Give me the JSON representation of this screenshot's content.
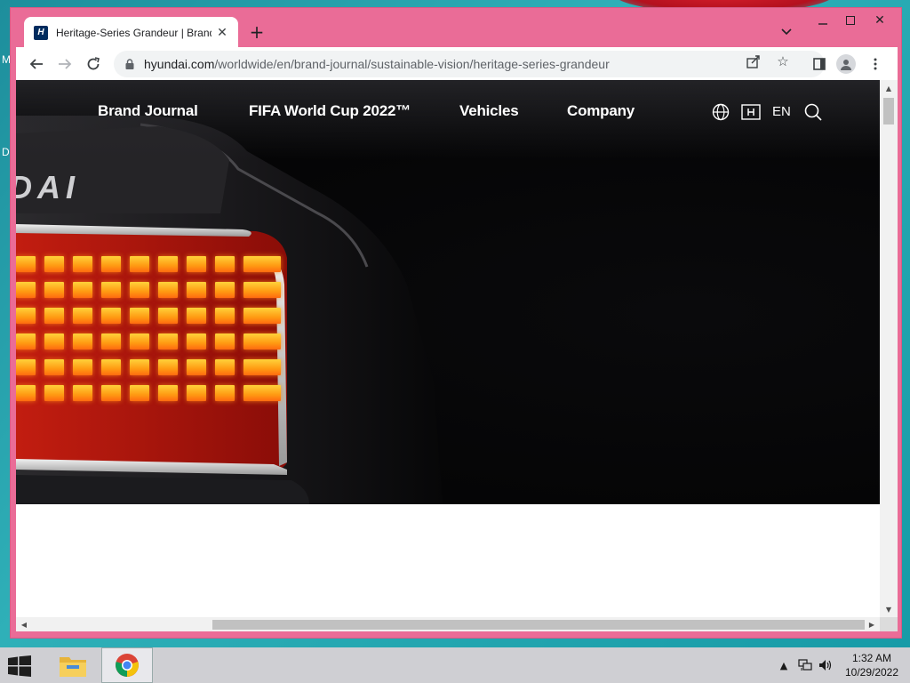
{
  "desktop": {
    "left_letters": [
      "M",
      "D"
    ]
  },
  "browser": {
    "tab": {
      "title": "Heritage-Series Grandeur | Brand Journal",
      "favicon": "hyundai-logo-icon"
    },
    "url_host": "hyundai.com",
    "url_path": "/worldwide/en/brand-journal/sustainable-vision/heritage-series-grandeur",
    "theme_color": "#ea6c97"
  },
  "site": {
    "nav": {
      "brand_journal": "Brand Journal",
      "fifa": "FIFA World Cup 2022™",
      "vehicles": "Vehicles",
      "company": "Company"
    },
    "language": "EN",
    "hero_brand_text": "DAI"
  },
  "taskbar": {
    "time": "1:32 AM",
    "date": "10/29/2022"
  }
}
